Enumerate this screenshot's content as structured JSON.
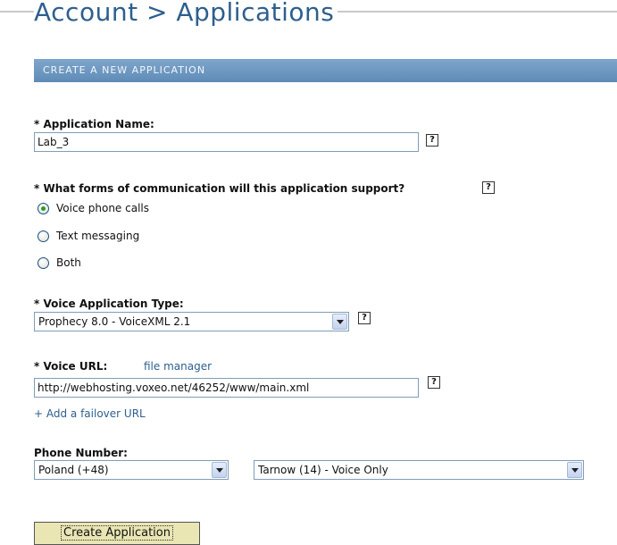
{
  "header": {
    "title": "Account > Applications",
    "section": "CREATE A NEW APPLICATION"
  },
  "form": {
    "app_name_label": "* Application Name:",
    "app_name_value": "Lab_3",
    "help_glyph": "?",
    "communication_label": "* What forms of communication will this application support?",
    "communication_options": [
      "Voice phone calls",
      "Text messaging",
      "Both"
    ],
    "communication_selected": "Voice phone calls",
    "voice_type_label": "* Voice Application Type:",
    "voice_type_value": "Prophecy 8.0 - VoiceXML 2.1",
    "voice_url_label": "* Voice URL:",
    "file_manager_link": "file manager",
    "voice_url_value": "http://webhosting.voxeo.net/46252/www/main.xml",
    "failover_link": "+ Add a failover URL",
    "phone_label": "Phone Number:",
    "country_value": "Poland (+48)",
    "city_value": "Tarnow (14) - Voice Only",
    "submit_label": "Create Application"
  },
  "colors": {
    "title": "#2d5f8e",
    "section_bar": "#6f97c0",
    "button_bg": "#e9e6b4",
    "radio_selected": "#21a121"
  }
}
